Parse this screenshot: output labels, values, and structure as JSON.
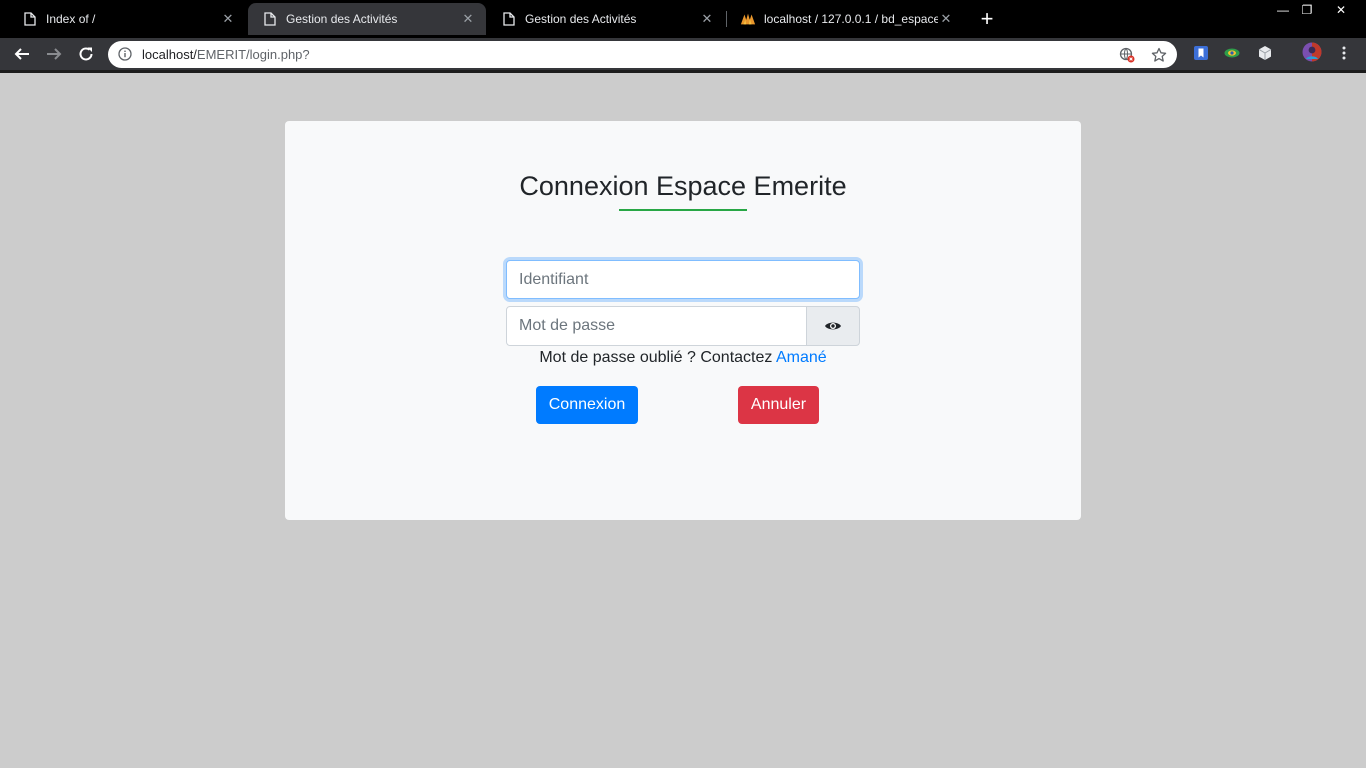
{
  "browser": {
    "tabs": [
      {
        "title": "Index of /",
        "icon": "page-icon",
        "active": false
      },
      {
        "title": "Gestion des Activités",
        "icon": "page-icon",
        "active": true
      },
      {
        "title": "Gestion des Activités",
        "icon": "page-icon",
        "active": false
      },
      {
        "title": "localhost / 127.0.0.1 / bd_espace",
        "icon": "phpmyadmin-icon",
        "active": false
      }
    ],
    "tab_close": "✕",
    "new_tab": "+",
    "window_controls": {
      "minimize": "—",
      "restore": "❐",
      "close": "✕"
    },
    "address": {
      "host": "localhost/",
      "path": "EMERIT/login.php?"
    }
  },
  "page": {
    "title": "Connexion Espace Emerite",
    "accent_color": "#28a745",
    "login_placeholder": "Identifiant",
    "password_placeholder": "Mot de passe",
    "forgot_text": "Mot de passe oublié ? Contactez",
    "forgot_link": "Amané",
    "connect_label": "Connexion",
    "cancel_label": "Annuler",
    "colors": {
      "primary": "#007bff",
      "danger": "#dc3545",
      "card": "#f8f9fa",
      "background": "#cccccc"
    }
  }
}
